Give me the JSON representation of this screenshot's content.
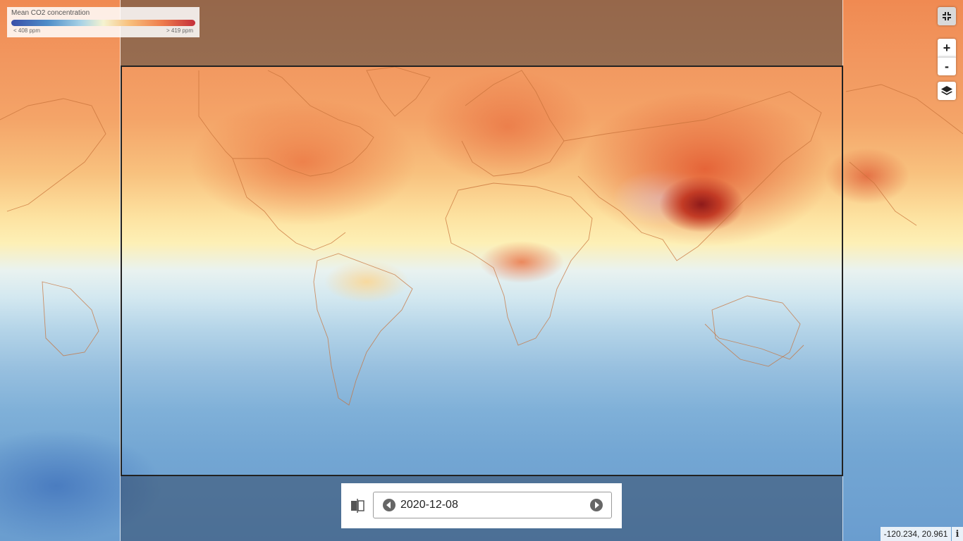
{
  "legend": {
    "title": "Mean CO2 concentration",
    "min_label": "< 408 ppm",
    "max_label": "> 419 ppm",
    "colors": [
      "#3a4fa8",
      "#4f8ec9",
      "#f5f3d0",
      "#ee7c4c",
      "#c42f3a"
    ]
  },
  "controls": {
    "collapse_icon": "collapse-arrows-icon",
    "zoom_in": "+",
    "zoom_out": "-",
    "layers_icon": "layers-icon"
  },
  "datebar": {
    "compare_icon": "compare-split-icon",
    "prev_icon": "chevron-left-circle-icon",
    "date": "2020-12-08",
    "next_icon": "chevron-right-circle-icon"
  },
  "status": {
    "coordinates": "-120.234, 20.961",
    "info_icon": "info-icon"
  }
}
